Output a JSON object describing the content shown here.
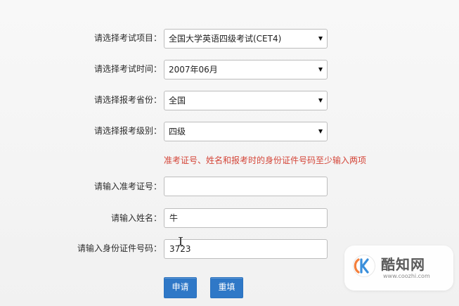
{
  "form": {
    "exam_item": {
      "label": "请选择考试项目：",
      "value": "全国大学英语四级考试(CET4)"
    },
    "exam_time": {
      "label": "请选择考试时间：",
      "value": "2007年06月"
    },
    "province": {
      "label": "请选择报考省份：",
      "value": "全国"
    },
    "level": {
      "label": "请选择报考级别：",
      "value": "四级"
    },
    "hint": "准考证号、姓名和报考时的身份证件号码至少输入两项",
    "ticket": {
      "label": "请输入准考证号：",
      "value": ""
    },
    "name": {
      "label": "请输入姓名：",
      "value": "牛"
    },
    "id_number": {
      "label": "请输入身份证件号码：",
      "value": "3723"
    },
    "submit_label": "申请",
    "reset_label": "重填"
  },
  "watermark": {
    "logo_icon": "kuzhi-logo-icon",
    "text": "酷知网",
    "url": "www.coozhi.com"
  }
}
